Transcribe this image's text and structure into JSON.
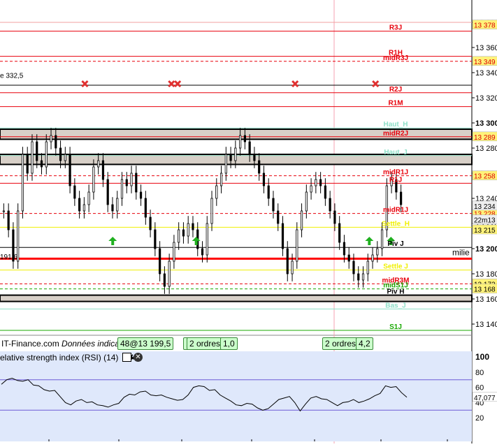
{
  "colors": {
    "main_bg": "#ffffff",
    "rsi_bg": "#dfe8fb",
    "candle": "#000000",
    "resistance": "#e8000b",
    "support": "#18a800",
    "mid_line": "#f05050",
    "thick_red": "#ff0000",
    "yellow_line": "#f0f000",
    "cursor_line": "#f4a0b0",
    "price_tag_bg": "#fff37a",
    "rsi_line": "#000000",
    "rsi_band": "#6d5bd6"
  },
  "price_axis": {
    "min": 13130,
    "max": 13385,
    "ticks": [
      "13 380",
      "13 360",
      "13 340",
      "13 320",
      "13 300",
      "13 280",
      "13 260",
      "13 240",
      "13 220",
      "13 200",
      "13 180",
      "13 160",
      "13 140"
    ]
  },
  "levels": [
    {
      "label": "R3J",
      "price": 13373,
      "color": "#e8000b",
      "style": "solid"
    },
    {
      "label": "R1H",
      "price": 13353,
      "color": "#e8000b",
      "style": "solid"
    },
    {
      "label": "midR3J",
      "price": 13349,
      "color": "#e8000b",
      "style": "dashed"
    },
    {
      "label": "R2J",
      "price": 13324,
      "color": "#e8000b",
      "style": "solid"
    },
    {
      "label": "R1M",
      "price": 13313,
      "color": "#e8000b",
      "style": "solid"
    },
    {
      "label": "Haut_H",
      "price": 13296,
      "color": "#8ee0c8",
      "style": "solid"
    },
    {
      "label": "midR2J",
      "price": 13289,
      "color": "#e8000b",
      "style": "solid"
    },
    {
      "label": "Haut_J",
      "price": 13274,
      "color": "#8ee0c8",
      "style": "solid"
    },
    {
      "label": "midR1J",
      "price": 13258,
      "color": "#e8000b",
      "style": "dashed"
    },
    {
      "label": "R1J",
      "price": 13252,
      "color": "#e8000b",
      "style": "solid"
    },
    {
      "label": "midR1J",
      "price": 13228,
      "color": "#e8000b",
      "style": "dashed"
    },
    {
      "label": "Settle_H",
      "price": 13217,
      "color": "#f0f000",
      "style": "solid"
    },
    {
      "label": "Piv J",
      "price": 13201,
      "color": "#000000",
      "style": "solid"
    },
    {
      "label": "Settle J",
      "price": 13183,
      "color": "#f0f000",
      "style": "solid"
    },
    {
      "label": "midR3M",
      "price": 13172,
      "color": "#e8000b",
      "style": "dashed"
    },
    {
      "label": "midS1J",
      "price": 13168,
      "color": "#18a800",
      "style": "dashed"
    },
    {
      "label": "Piv H",
      "price": 13163,
      "color": "#000000",
      "style": "solid"
    },
    {
      "label": "Bas_J",
      "price": 13152,
      "color": "#8ee0c8",
      "style": "solid"
    },
    {
      "label": "S1J",
      "price": 13135,
      "color": "#18a800",
      "style": "solid"
    }
  ],
  "extra_lines": [
    {
      "price": 13330,
      "color": "#000000"
    },
    {
      "price": 13192,
      "color": "#ff0000"
    },
    {
      "price": 13380,
      "color": "#f0a0a0"
    }
  ],
  "zones": [
    {
      "top": 13295,
      "bottom": 13287
    },
    {
      "top": 13275,
      "bottom": 13267
    },
    {
      "top": 13163,
      "bottom": 13158
    }
  ],
  "price_tags": [
    {
      "text": "13 378",
      "price": 13378
    },
    {
      "text": "13 349",
      "price": 13349
    },
    {
      "text": "13 289",
      "price": 13289
    },
    {
      "text": "13 258",
      "price": 13258
    },
    {
      "text": "13 228",
      "price": 13228
    },
    {
      "text": "13 215",
      "price": 13215
    },
    {
      "text": "13 172",
      "price": 13172
    },
    {
      "text": "13 168",
      "price": 13168
    }
  ],
  "info_tags": [
    {
      "text": "13 234",
      "price": 13234
    },
    {
      "text": "22m13",
      "price": 13223
    }
  ],
  "left_labels": [
    {
      "text": "e 332,5",
      "price": 13338
    },
    {
      "text": "191,6",
      "price": 13194
    }
  ],
  "side_text": {
    "text": "milie",
    "price": 13197
  },
  "order_boxes": [
    {
      "text": "48@13 199,5",
      "x": 168
    },
    {
      "text": "1",
      "x": 262
    },
    {
      "text": "2 ordres",
      "x": 267
    },
    {
      "text": "1,0",
      "x": 315
    },
    {
      "text": "2 ordres",
      "x": 461
    },
    {
      "text": "4,2",
      "x": 509
    }
  ],
  "watermark": {
    "source": "IT-Finance.com",
    "note": "Données indicatives"
  },
  "rsi_panel": {
    "title": "elative strength index (RSI) (14)",
    "value": "47,077",
    "ticks": [
      "100",
      "80",
      "60",
      "40",
      "20"
    ],
    "upper": 70,
    "lower": 30
  },
  "chart_data": {
    "type": "candlestick",
    "title": "",
    "ylabel": "",
    "ylim": [
      13130,
      13385
    ],
    "close_series": [
      13230,
      13215,
      13190,
      13230,
      13275,
      13260,
      13285,
      13270,
      13265,
      13285,
      13290,
      13280,
      13270,
      13275,
      13250,
      13240,
      13230,
      13235,
      13245,
      13265,
      13270,
      13255,
      13235,
      13230,
      13240,
      13255,
      13250,
      13260,
      13245,
      13240,
      13225,
      13215,
      13200,
      13180,
      13170,
      13190,
      13205,
      13215,
      13210,
      13220,
      13215,
      13200,
      13195,
      13220,
      13240,
      13250,
      13260,
      13275,
      13270,
      13280,
      13290,
      13285,
      13275,
      13270,
      13260,
      13250,
      13240,
      13230,
      13220,
      13200,
      13180,
      13190,
      13215,
      13230,
      13245,
      13250,
      13255,
      13250,
      13240,
      13230,
      13220,
      13205,
      13195,
      13190,
      13180,
      13175,
      13180,
      13190,
      13195,
      13200,
      13215,
      13250,
      13255,
      13245,
      13235
    ],
    "sell_markers": [
      {
        "i": 27
      },
      {
        "i": 55
      },
      {
        "i": 57
      },
      {
        "i": 95
      },
      {
        "i": 121
      }
    ],
    "buy_markers": [
      {
        "i": 36
      },
      {
        "i": 63
      },
      {
        "i": 119
      },
      {
        "i": 126
      }
    ],
    "rsi_values": [
      64,
      70,
      72,
      69,
      68,
      70,
      63,
      62,
      57,
      55,
      56,
      48,
      40,
      37,
      42,
      44,
      40,
      41,
      37,
      36,
      34,
      37,
      39,
      47,
      51,
      50,
      54,
      55,
      50,
      49,
      50,
      47,
      45,
      43,
      44,
      50,
      60,
      62,
      61,
      56,
      57,
      50,
      46,
      42,
      37,
      36,
      39,
      38,
      33,
      30,
      32,
      38,
      44,
      46,
      48,
      40,
      29,
      38,
      46,
      48,
      45,
      44,
      40,
      36,
      40,
      41,
      44,
      40,
      42,
      45,
      49,
      52,
      62,
      60,
      61,
      53,
      47
    ]
  }
}
